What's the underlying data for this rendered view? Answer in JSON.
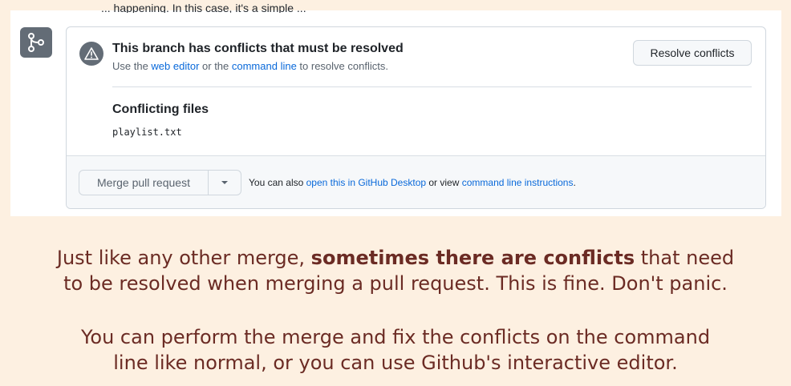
{
  "top_partial_text": "... happening. In this case, it's a simple ...",
  "conflict_box": {
    "title": "This branch has conflicts that must be resolved",
    "sub_prefix": "Use the ",
    "web_editor_link": "web editor",
    "sub_middle": " or the ",
    "command_line_link": "command line",
    "sub_suffix": " to resolve conflicts.",
    "resolve_button": "Resolve conflicts",
    "conflicting_title": "Conflicting files",
    "files": [
      "playlist.txt"
    ]
  },
  "footer": {
    "merge_button": "Merge pull request",
    "prefix": "You can also ",
    "desktop_link": "open this in GitHub Desktop",
    "middle": " or view ",
    "instructions_link": "command line instructions",
    "suffix": "."
  },
  "caption": {
    "p1_prefix": "Just like any other merge, ",
    "p1_bold": "sometimes there are conflicts",
    "p1_suffix": " that need",
    "p1_line2": "to be resolved when merging a pull request. This is fine. Don't panic.",
    "p2_line1": "You can perform the merge and fix the conflicts on the command",
    "p2_line2": "line like normal, or you can use Github's interactive editor."
  },
  "colors": {
    "background": "#fdf0e1",
    "caption": "#6b2b24",
    "link": "#0969da"
  },
  "icons": [
    "merge-icon",
    "warning-icon",
    "caret-down-icon"
  ]
}
